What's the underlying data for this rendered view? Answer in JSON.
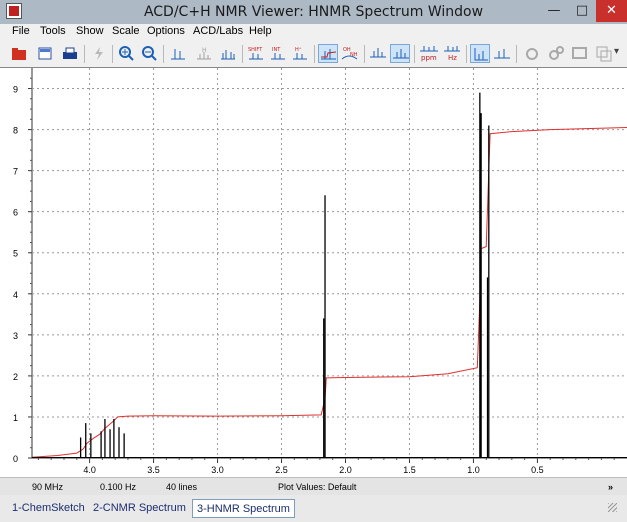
{
  "window": {
    "title": "ACD/C+H NMR Viewer: HNMR Spectrum Window",
    "min_glyph": "—",
    "max_glyph": "□",
    "close_glyph": "✕"
  },
  "menu": [
    {
      "label": "File"
    },
    {
      "label": "Tools"
    },
    {
      "label": "Show"
    },
    {
      "label": "Scale"
    },
    {
      "label": "Options"
    },
    {
      "label": "ACD/Labs"
    },
    {
      "label": "Help"
    }
  ],
  "toolbar": {
    "shift_label": "SHIFT",
    "int_label": "INT",
    "hplus_label": "H⁺",
    "oh_label": "OH",
    "nh_label": "NH",
    "ppm_label": "ppm",
    "hz_label": "Hz",
    "overflow_glyph": "▾"
  },
  "status": {
    "frequency": "90 MHz",
    "resolution": "0.100 Hz",
    "lines": "40 lines",
    "plot_values": "Plot Values: Default",
    "more_glyph": "»"
  },
  "tabs": [
    {
      "label": "1-ChemSketch",
      "active": false
    },
    {
      "label": "2-CNMR Spectrum",
      "active": false
    },
    {
      "label": "3-HNMR Spectrum",
      "active": true
    }
  ],
  "chart_data": {
    "type": "line",
    "title": "",
    "xlabel": "",
    "ylabel": "",
    "x_axis_reversed": true,
    "xlim": [
      4.45,
      -0.2
    ],
    "ylim": [
      0,
      9.5
    ],
    "x_ticks": [
      "4.0",
      "3.5",
      "3.0",
      "2.5",
      "2.0",
      "1.5",
      "1.0",
      "0.5"
    ],
    "x_tick_values": [
      4.0,
      3.5,
      3.0,
      2.5,
      2.0,
      1.5,
      1.0,
      0.5
    ],
    "y_ticks": [
      "0",
      "1",
      "2",
      "3",
      "4",
      "5",
      "6",
      "7",
      "8",
      "9"
    ],
    "y_tick_values": [
      0,
      1,
      2,
      3,
      4,
      5,
      6,
      7,
      8,
      9
    ],
    "grid": true,
    "series": [
      {
        "color": "#000000",
        "peaks": [
          {
            "x": 4.07,
            "y": 0.5
          },
          {
            "x": 4.03,
            "y": 0.85
          },
          {
            "x": 3.99,
            "y": 0.6
          },
          {
            "x": 3.91,
            "y": 0.65
          },
          {
            "x": 3.88,
            "y": 0.95
          },
          {
            "x": 3.84,
            "y": 0.7
          },
          {
            "x": 3.81,
            "y": 0.95
          },
          {
            "x": 3.77,
            "y": 0.75
          },
          {
            "x": 3.73,
            "y": 0.6
          },
          {
            "x": 2.17,
            "y": 3.4
          },
          {
            "x": 2.16,
            "y": 6.4
          },
          {
            "x": 0.95,
            "y": 8.9
          },
          {
            "x": 0.94,
            "y": 8.4
          },
          {
            "x": 0.89,
            "y": 4.4
          },
          {
            "x": 0.88,
            "y": 8.1
          }
        ]
      },
      {
        "color": "#e03030",
        "points": [
          [
            4.45,
            0.02
          ],
          [
            4.25,
            0.06
          ],
          [
            4.1,
            0.12
          ],
          [
            4.05,
            0.22
          ],
          [
            4.02,
            0.36
          ],
          [
            3.97,
            0.48
          ],
          [
            3.92,
            0.58
          ],
          [
            3.88,
            0.72
          ],
          [
            3.82,
            0.88
          ],
          [
            3.78,
            1.0
          ],
          [
            3.7,
            1.02
          ],
          [
            3.5,
            1.03
          ],
          [
            3.0,
            1.02
          ],
          [
            2.5,
            1.03
          ],
          [
            2.19,
            1.05
          ],
          [
            2.16,
            1.45
          ],
          [
            2.15,
            1.95
          ],
          [
            2.0,
            1.96
          ],
          [
            1.5,
            1.98
          ],
          [
            1.2,
            2.05
          ],
          [
            0.97,
            2.2
          ],
          [
            0.95,
            3.8
          ],
          [
            0.94,
            5.1
          ],
          [
            0.9,
            5.15
          ],
          [
            0.88,
            7.0
          ],
          [
            0.87,
            7.9
          ],
          [
            0.7,
            7.95
          ],
          [
            0.4,
            8.0
          ],
          [
            -0.2,
            8.05
          ]
        ]
      }
    ]
  }
}
